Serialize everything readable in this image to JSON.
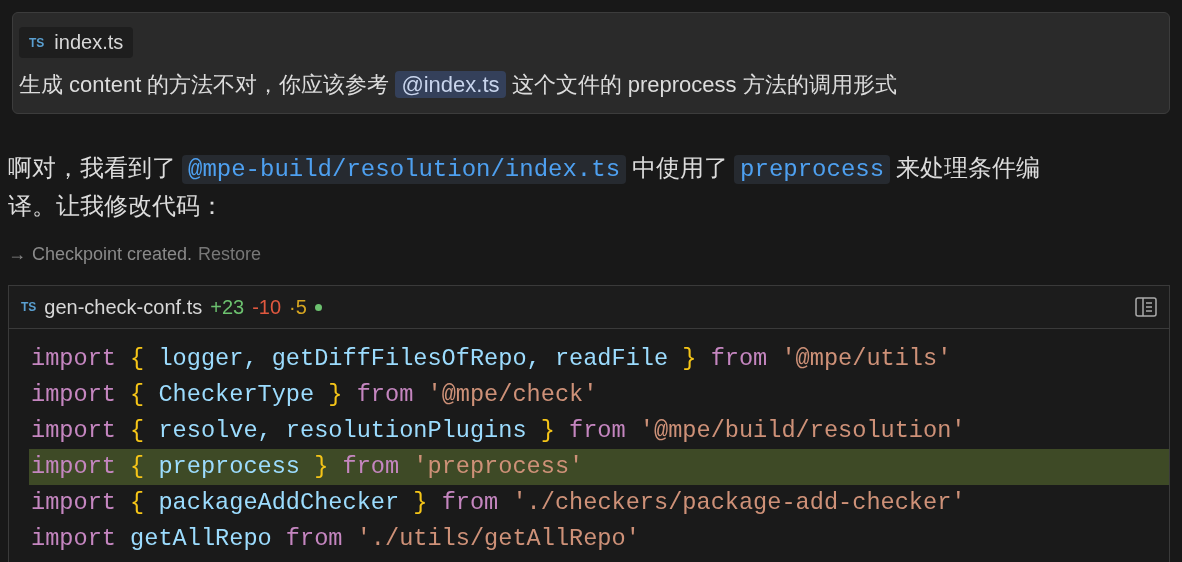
{
  "user_message": {
    "attachment": {
      "badge": "TS",
      "name": "index.ts"
    },
    "segments": [
      {
        "kind": "text",
        "text": "生成 content 的方法不对，你应该参考"
      },
      {
        "kind": "mention",
        "text": "@index.ts"
      },
      {
        "kind": "text",
        "text": "这个文件的 preprocess 方法的调用形式"
      }
    ]
  },
  "reply": {
    "lines": [
      [
        {
          "kind": "text",
          "text": "啊对，我看到了"
        },
        {
          "kind": "code",
          "text": "@mpe-build/resolution/index.ts"
        },
        {
          "kind": "text",
          "text": "中使用了"
        },
        {
          "kind": "code",
          "text": "preprocess"
        },
        {
          "kind": "text",
          "text": "来处理条件编"
        }
      ],
      [
        {
          "kind": "text",
          "text": "译。让我修改代码："
        }
      ]
    ]
  },
  "checkpoint": {
    "arrow": "→",
    "text": "Checkpoint created.",
    "link": "Restore"
  },
  "code_block": {
    "badge": "TS",
    "filename": "gen-check-conf.ts",
    "stats": [
      {
        "text": "+23",
        "color": "#6cc16f"
      },
      {
        "text": "-10",
        "color": "#e0583f"
      },
      {
        "text": "·5",
        "color": "#d6a520"
      }
    ],
    "status_dot": {
      "color": "#6cc16f"
    },
    "lines": [
      {
        "highlighted": false,
        "tokens": [
          {
            "kind": "keyword",
            "text": "import"
          },
          {
            "kind": "brace",
            "text": "{"
          },
          {
            "kind": "ident",
            "text": "logger, getDiffFilesOfRepo, readFile"
          },
          {
            "kind": "brace",
            "text": "}"
          },
          {
            "kind": "keyword",
            "text": "from"
          },
          {
            "kind": "string",
            "text": "'@mpe/utils'"
          }
        ]
      },
      {
        "highlighted": false,
        "tokens": [
          {
            "kind": "keyword",
            "text": "import"
          },
          {
            "kind": "brace",
            "text": "{"
          },
          {
            "kind": "ident",
            "text": "CheckerType"
          },
          {
            "kind": "brace",
            "text": "}"
          },
          {
            "kind": "keyword",
            "text": "from"
          },
          {
            "kind": "string",
            "text": "'@mpe/check'"
          }
        ]
      },
      {
        "highlighted": false,
        "tokens": [
          {
            "kind": "keyword",
            "text": "import"
          },
          {
            "kind": "brace",
            "text": "{"
          },
          {
            "kind": "ident",
            "text": "resolve, resolutionPlugins"
          },
          {
            "kind": "brace",
            "text": "}"
          },
          {
            "kind": "keyword",
            "text": "from"
          },
          {
            "kind": "string",
            "text": "'@mpe/build/resolution'"
          }
        ]
      },
      {
        "highlighted": true,
        "tokens": [
          {
            "kind": "keyword",
            "text": "import"
          },
          {
            "kind": "brace",
            "text": "{"
          },
          {
            "kind": "ident",
            "text": "preprocess"
          },
          {
            "kind": "brace",
            "text": "}"
          },
          {
            "kind": "keyword",
            "text": "from"
          },
          {
            "kind": "string",
            "text": "'preprocess'"
          }
        ]
      },
      {
        "highlighted": false,
        "tokens": [
          {
            "kind": "keyword",
            "text": "import"
          },
          {
            "kind": "brace",
            "text": "{"
          },
          {
            "kind": "ident",
            "text": "packageAddChecker"
          },
          {
            "kind": "brace",
            "text": "}"
          },
          {
            "kind": "keyword",
            "text": "from"
          },
          {
            "kind": "string",
            "text": "'./checkers/package-add-checker'"
          }
        ]
      },
      {
        "highlighted": false,
        "tokens": [
          {
            "kind": "keyword",
            "text": "import"
          },
          {
            "kind": "ident",
            "text": "getAllRepo"
          },
          {
            "kind": "keyword",
            "text": "from"
          },
          {
            "kind": "string",
            "text": "'./utils/getAllRepo'"
          }
        ]
      }
    ]
  }
}
